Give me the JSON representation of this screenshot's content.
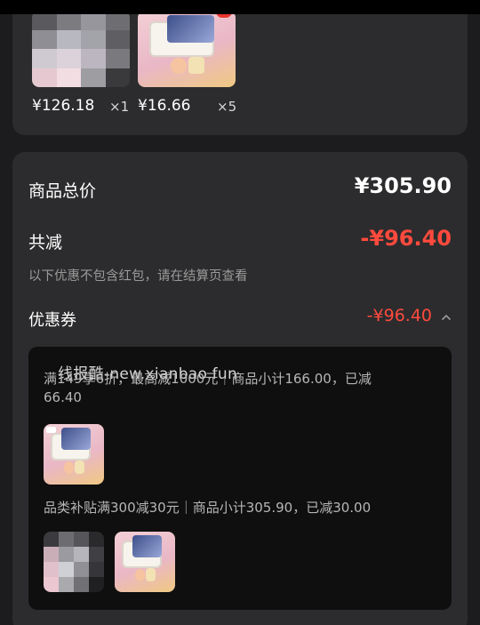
{
  "products_card": {
    "items": [
      {
        "price": "¥126.18",
        "qty": "×1",
        "image": "pixelated-product",
        "blurred": true
      },
      {
        "price": "¥16.66",
        "qty": "×5",
        "image": "lunch-box-product"
      }
    ]
  },
  "summary": {
    "total_label": "商品总价",
    "total_value": "¥305.90",
    "discount_label": "共减",
    "discount_value": "-¥96.40",
    "discount_color": "#ff4a3d",
    "note": "以下优惠不包含红包，请在结算页查看",
    "coupon_label": "优惠券",
    "coupon_value": "-¥96.40",
    "coupon_expand_icon": "chevron-up-icon"
  },
  "coupon_details": {
    "watermark": "线报酷-new.xianbao.fun",
    "rules": [
      {
        "line1": "满149享6折，最高减1000元｜商品小计166.00，已减",
        "line2": "66.40"
      },
      {
        "line1": "品类补贴满300减30元｜商品小计305.90，已减30.00",
        "line2": ""
      }
    ]
  },
  "colors": {
    "background": "#1c1c1e",
    "card": "#2c2c2e",
    "inner_panel": "#0f0f0f",
    "accent_red": "#ff4a3d"
  }
}
